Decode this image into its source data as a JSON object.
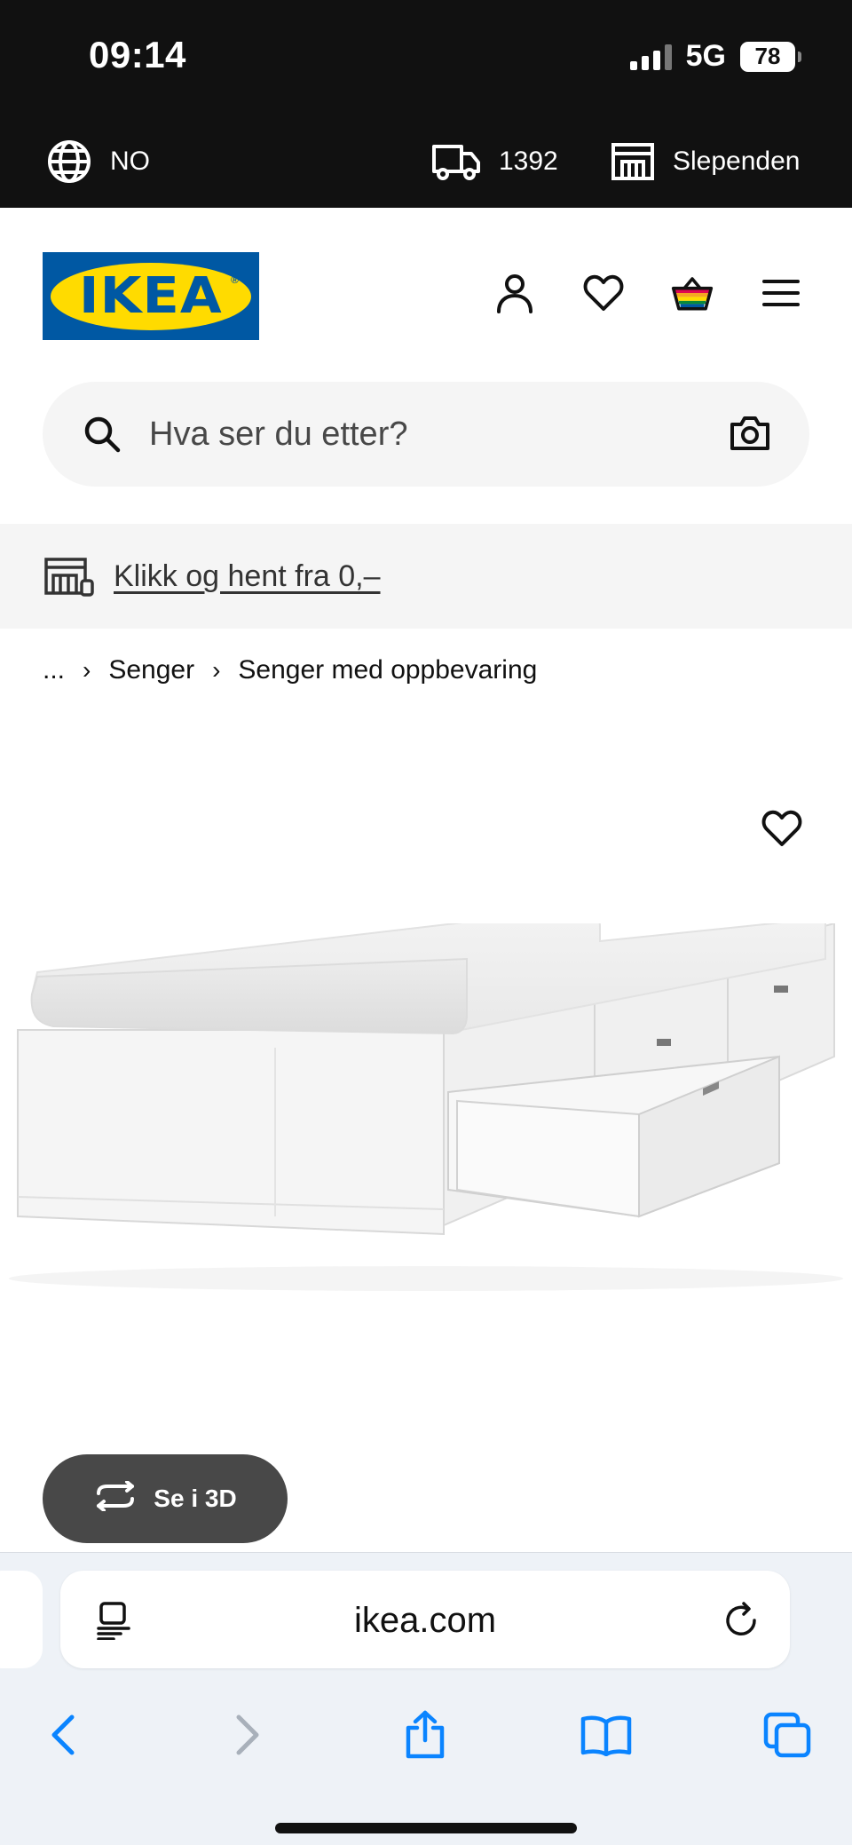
{
  "status_bar": {
    "time": "09:14",
    "network": "5G",
    "battery": "78"
  },
  "store_bar": {
    "country": "NO",
    "postal_code": "1392",
    "store": "Slependen"
  },
  "header": {
    "logo_text": "IKEA",
    "logo_reg": "®"
  },
  "search": {
    "placeholder": "Hva ser du etter?"
  },
  "promo": {
    "text": "Klikk og hent fra 0,–"
  },
  "breadcrumb": {
    "ellipsis": "...",
    "items": [
      "Senger",
      "Senger med oppbevaring"
    ]
  },
  "product": {
    "view_3d_label": "Se i 3D"
  },
  "browser": {
    "url": "ikea.com"
  },
  "icons": {
    "country": "globe-icon",
    "delivery": "truck-icon",
    "store": "store-icon",
    "account": "user-icon",
    "wishlist": "heart-icon",
    "cart": "shopping-bag-icon",
    "menu": "hamburger-menu-icon",
    "search": "search-icon",
    "camera": "camera-icon",
    "promo": "click-collect-icon",
    "favourite": "heart-icon",
    "rotate": "rotate-3d-icon",
    "reader": "reader-icon",
    "reload": "reload-icon",
    "back": "chevron-left-icon",
    "forward": "chevron-right-icon",
    "share": "share-icon",
    "bookmarks": "book-icon",
    "tabs": "tabs-icon"
  },
  "colors": {
    "ikea_blue": "#0058a3",
    "ikea_yellow": "#ffdb00",
    "ios_blue": "#0a84ff"
  }
}
